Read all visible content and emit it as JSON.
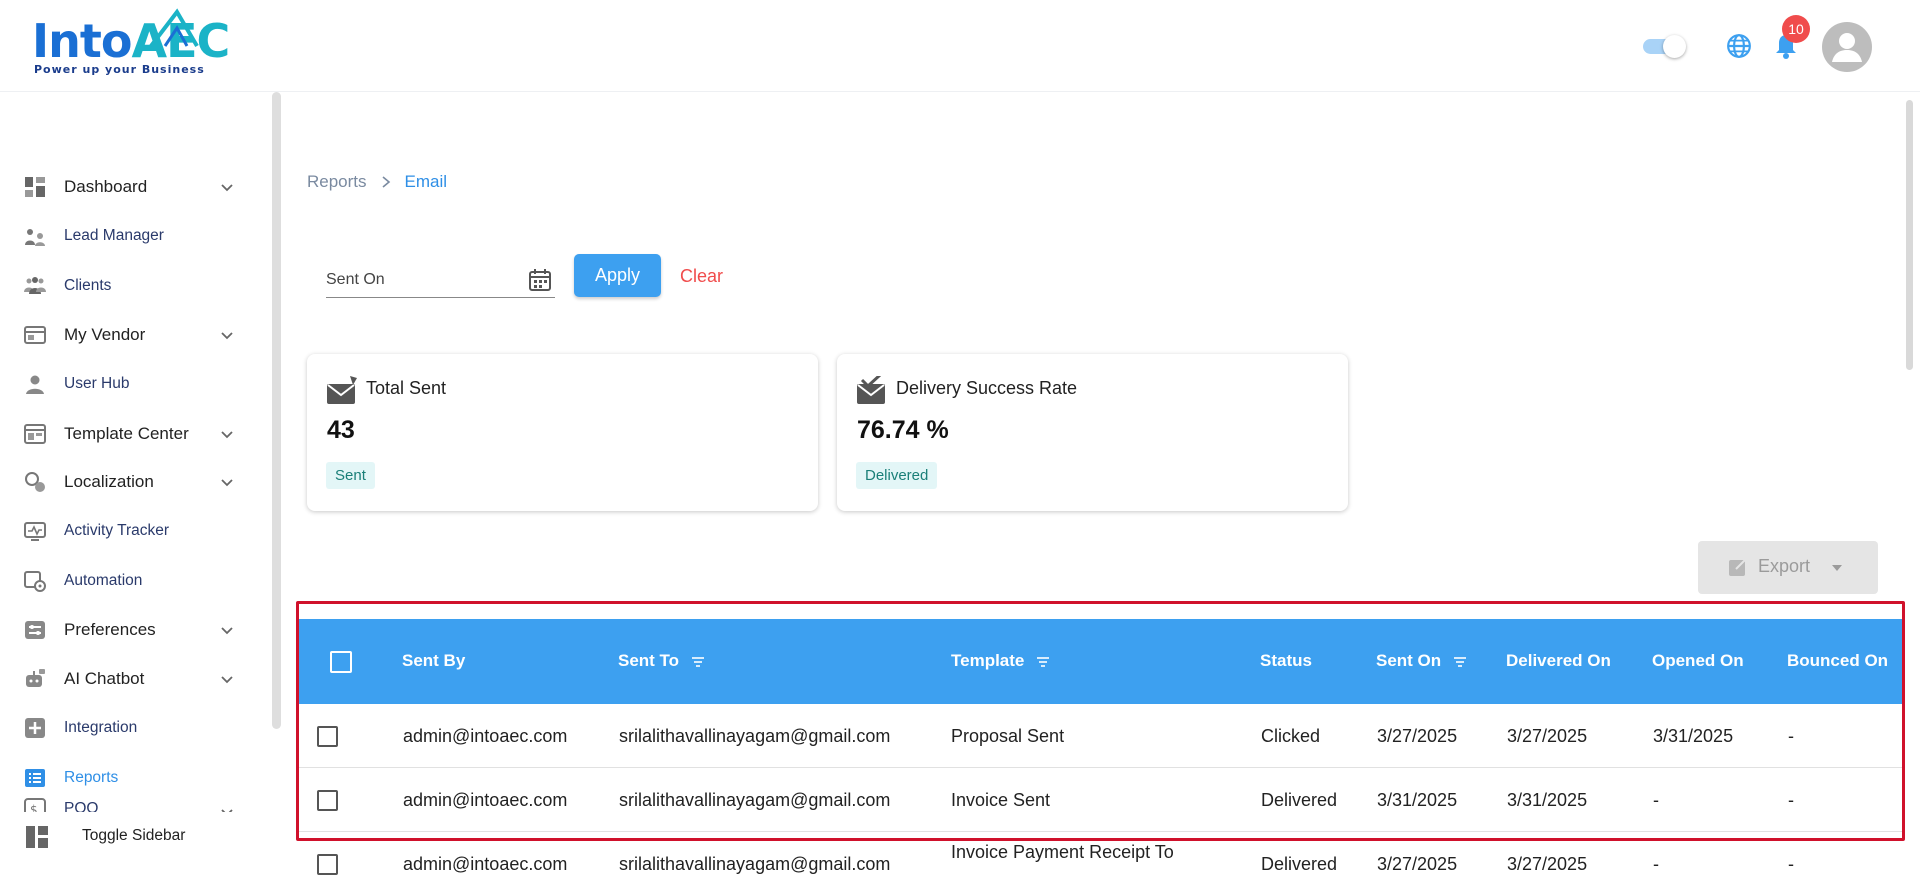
{
  "header": {
    "logo_word_a": "Into",
    "logo_word_b": "AEC",
    "logo_tagline": "Power up your Business",
    "notification_count": "10",
    "accent": "#3da0f0"
  },
  "sidebar": {
    "items": [
      {
        "label": "Dashboard",
        "icon": "dashboard-icon",
        "expandable": true
      },
      {
        "label": "Lead Manager",
        "icon": "lead-manager-icon",
        "expandable": false
      },
      {
        "label": "Clients",
        "icon": "clients-icon",
        "expandable": false
      },
      {
        "label": "My Vendor",
        "icon": "vendor-icon",
        "expandable": true
      },
      {
        "label": "User Hub",
        "icon": "user-icon",
        "expandable": false
      },
      {
        "label": "Template Center",
        "icon": "template-icon",
        "expandable": true
      },
      {
        "label": "Localization",
        "icon": "localization-icon",
        "expandable": true
      },
      {
        "label": "Activity Tracker",
        "icon": "activity-icon",
        "expandable": false
      },
      {
        "label": "Automation",
        "icon": "automation-icon",
        "expandable": false
      },
      {
        "label": "Preferences",
        "icon": "preferences-icon",
        "expandable": true
      },
      {
        "label": "AI Chatbot",
        "icon": "chatbot-icon",
        "expandable": true
      },
      {
        "label": "Integration",
        "icon": "integration-icon",
        "expandable": false
      },
      {
        "label": "Reports",
        "icon": "reports-icon",
        "expandable": false,
        "active": true
      },
      {
        "label": "POO",
        "icon": "poo-icon",
        "expandable": true
      }
    ],
    "toggle_label": "Toggle Sidebar"
  },
  "breadcrumb": {
    "parent": "Reports",
    "current": "Email"
  },
  "filter": {
    "placeholder": "Sent On",
    "apply_label": "Apply",
    "clear_label": "Clear"
  },
  "cards": [
    {
      "title": "Total Sent",
      "value": "43",
      "tag": "Sent"
    },
    {
      "title": "Delivery Success Rate",
      "value": "76.74 %",
      "tag": "Delivered"
    }
  ],
  "export_label": "Export",
  "table": {
    "columns": [
      "Sent By",
      "Sent To",
      "Template",
      "Status",
      "Sent On",
      "Delivered On",
      "Opened On",
      "Bounced On"
    ],
    "rows": [
      [
        "admin@intoaec.com",
        "srilalithavallinayagam@gmail.com",
        "Proposal Sent",
        "Clicked",
        "3/27/2025",
        "3/27/2025",
        "3/31/2025",
        "-"
      ],
      [
        "admin@intoaec.com",
        "srilalithavallinayagam@gmail.com",
        "Invoice Sent",
        "Delivered",
        "3/31/2025",
        "3/31/2025",
        "-",
        "-"
      ],
      [
        "admin@intoaec.com",
        "srilalithavallinayagam@gmail.com",
        "Invoice Payment Receipt To",
        "Delivered",
        "3/27/2025",
        "3/27/2025",
        "-",
        "-"
      ]
    ]
  }
}
